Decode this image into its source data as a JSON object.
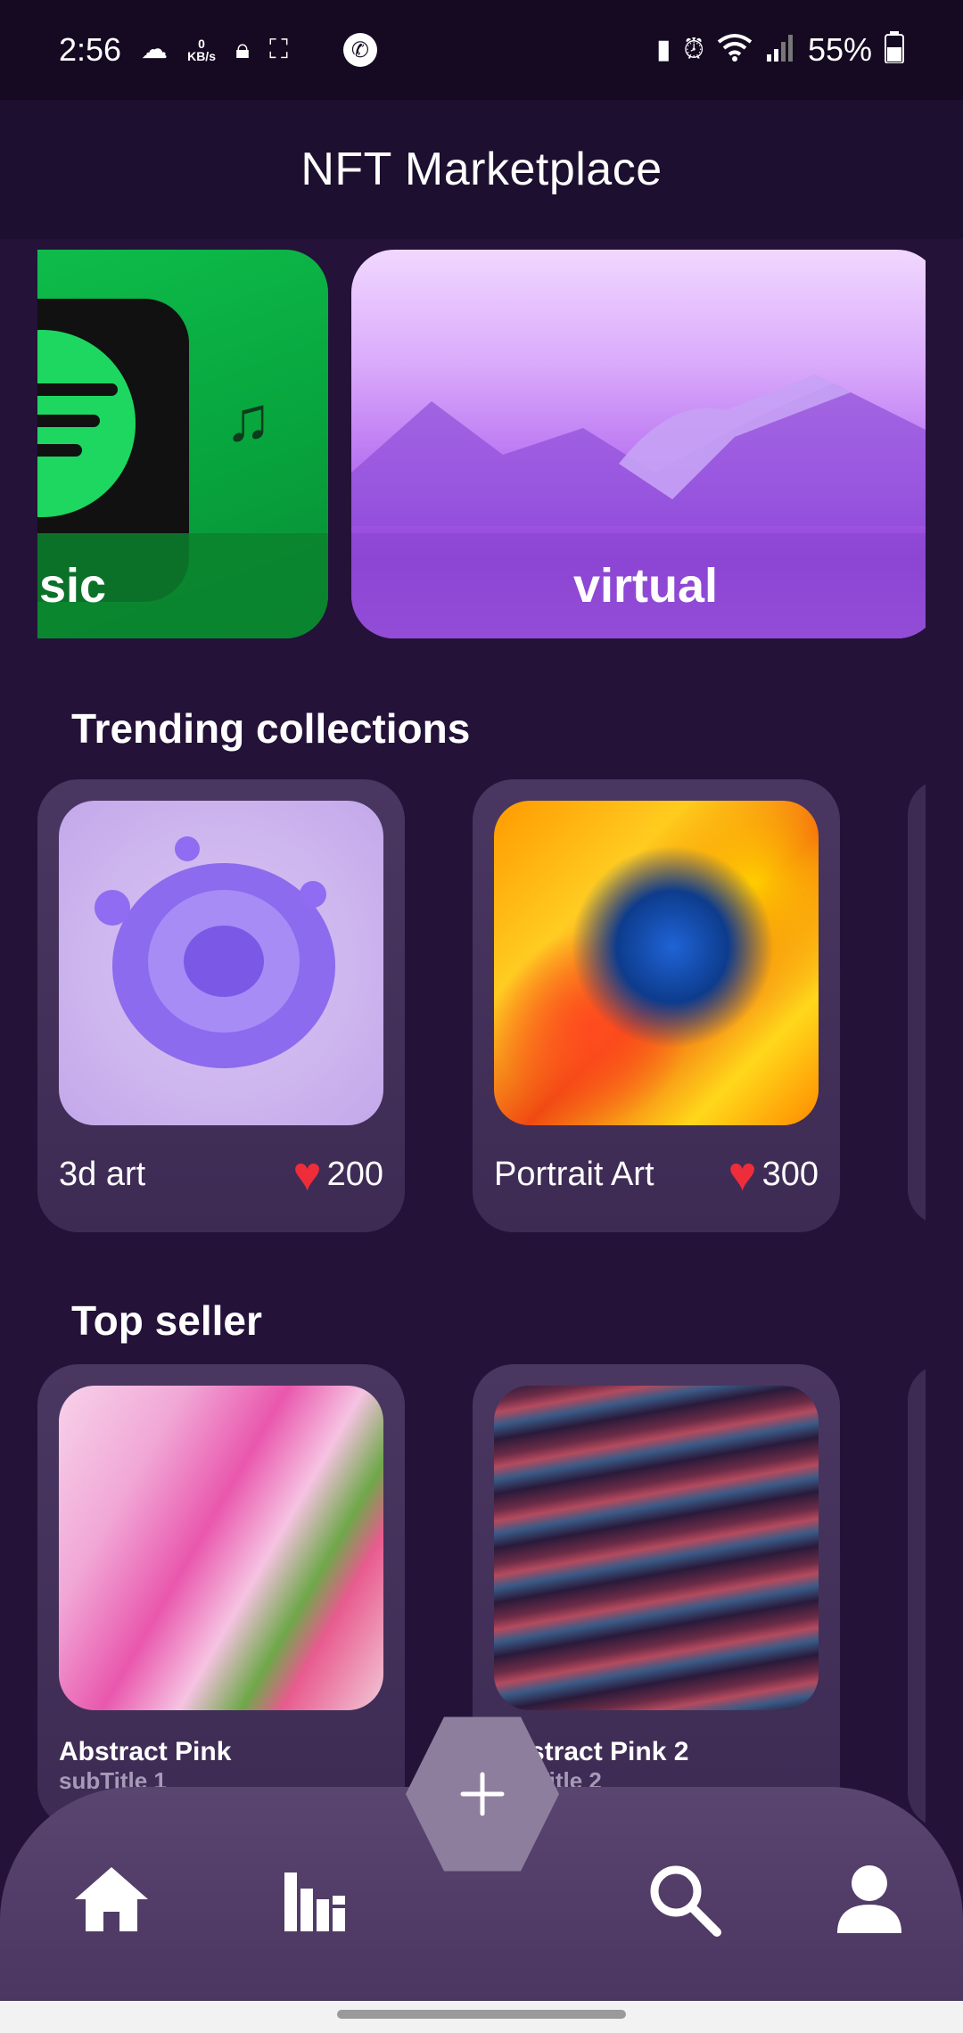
{
  "status_bar": {
    "time": "2:56",
    "net_speed_value": "0",
    "net_speed_unit": "KB/s",
    "battery": "55%"
  },
  "app_bar": {
    "title": "NFT Marketplace"
  },
  "categories": [
    {
      "label": "sic"
    },
    {
      "label": "virtual"
    }
  ],
  "trending": {
    "title": "Trending collections",
    "items": [
      {
        "name": "3d art",
        "likes": "200"
      },
      {
        "name": "Portrait Art",
        "likes": "300"
      }
    ]
  },
  "top_seller": {
    "title": "Top seller",
    "items": [
      {
        "name": "Abstract Pink",
        "subtitle": "subTitle 1"
      },
      {
        "name": "Abstract Pink 2",
        "subtitle": "subTitle 2"
      }
    ]
  },
  "colors": {
    "background": "#241239",
    "card": "#3d2b54",
    "heart": "#ef2d3a",
    "nav": "#4b3561",
    "fab": "#8e7e9d"
  },
  "bottom_nav": {
    "items": [
      "home-icon",
      "stats-icon",
      "add-icon",
      "search-icon",
      "profile-icon"
    ]
  }
}
